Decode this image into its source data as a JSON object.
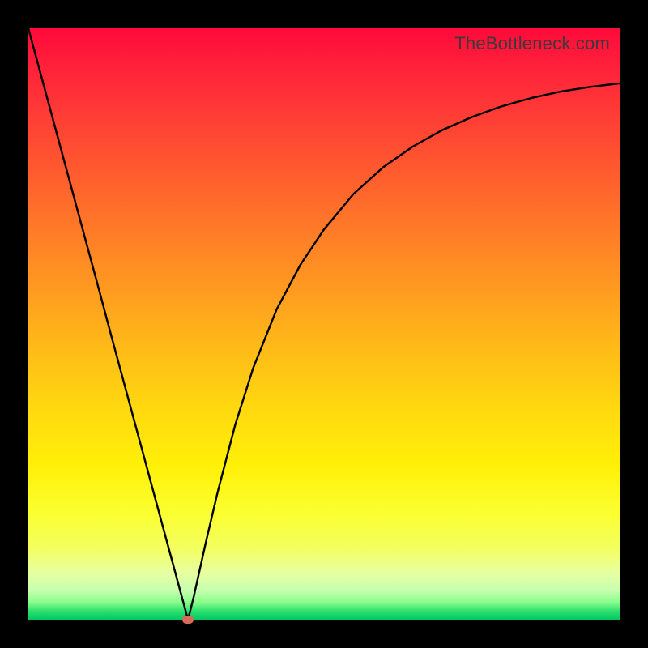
{
  "watermark": "TheBottleneck.com",
  "colors": {
    "frame": "#000000",
    "curve": "#000000",
    "marker": "#d66b5a"
  },
  "chart_data": {
    "type": "line",
    "title": "",
    "xlabel": "",
    "ylabel": "",
    "xlim": [
      0,
      100
    ],
    "ylim": [
      0,
      100
    ],
    "grid": false,
    "legend": false,
    "series": [
      {
        "name": "bottleneck-curve",
        "x": [
          0,
          2,
          4,
          6,
          8,
          10,
          12,
          14,
          16,
          18,
          20,
          22,
          24,
          26,
          27,
          28,
          30,
          32,
          35,
          38,
          42,
          46,
          50,
          55,
          60,
          65,
          70,
          75,
          80,
          85,
          90,
          95,
          100
        ],
        "y": [
          100,
          92.6,
          85.2,
          77.8,
          70.4,
          63.0,
          55.6,
          48.1,
          40.7,
          33.3,
          25.9,
          18.5,
          11.1,
          3.7,
          0.0,
          4.0,
          13.0,
          21.5,
          33.0,
          42.5,
          52.5,
          60.0,
          66.0,
          72.0,
          76.5,
          80.0,
          82.8,
          85.0,
          86.8,
          88.2,
          89.3,
          90.1,
          90.7
        ]
      }
    ],
    "marker": {
      "x": 27,
      "y": 0
    },
    "notes": "V-shaped curve: steep linear descent from top-left to minimum near x≈27, then asymptotic rise toward upper right. Y values estimated from pixel positions against gradient; chart has no axis tick labels."
  }
}
